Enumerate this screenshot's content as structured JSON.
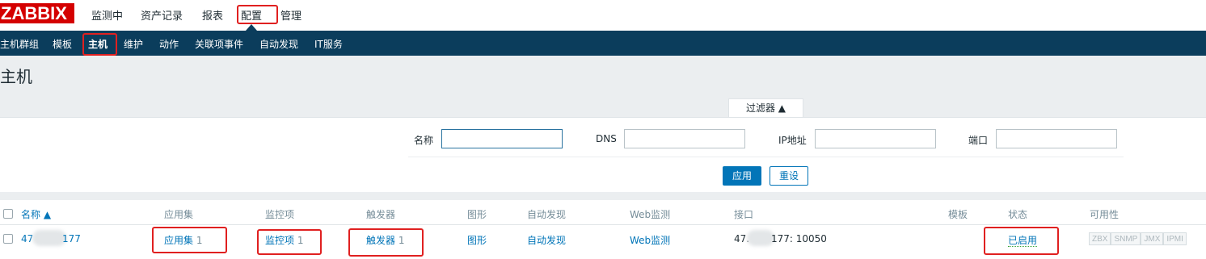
{
  "app": {
    "logo": "ZABBIX"
  },
  "top_menu": [
    {
      "label": "监测中"
    },
    {
      "label": "资产记录"
    },
    {
      "label": "报表"
    },
    {
      "label": "配置"
    },
    {
      "label": "管理"
    }
  ],
  "sub_menu": [
    {
      "label": "主机群组"
    },
    {
      "label": "模板"
    },
    {
      "label": "主机"
    },
    {
      "label": "维护"
    },
    {
      "label": "动作"
    },
    {
      "label": "关联项事件"
    },
    {
      "label": "自动发现"
    },
    {
      "label": "IT服务"
    }
  ],
  "page": {
    "title": "主机"
  },
  "filter": {
    "tab_label": "过滤器 ▲",
    "name_label": "名称",
    "name_value": "",
    "dns_label": "DNS",
    "dns_value": "",
    "ip_label": "IP地址",
    "ip_value": "",
    "port_label": "端口",
    "port_value": "",
    "apply_label": "应用",
    "reset_label": "重设"
  },
  "table": {
    "headers": {
      "name": "名称 ▲",
      "applications": "应用集",
      "items": "监控项",
      "triggers": "触发器",
      "graphs": "图形",
      "discovery": "自动发现",
      "web": "Web监测",
      "interface": "接口",
      "templates": "模板",
      "status": "状态",
      "availability": "可用性"
    },
    "rows": [
      {
        "name_prefix": "47",
        "name_suffix": "177",
        "applications": "应用集",
        "applications_count": "1",
        "items": "监控项",
        "items_count": "1",
        "triggers": "触发器",
        "triggers_count": "1",
        "graphs": "图形",
        "discovery": "自动发现",
        "web": "Web监测",
        "interface_prefix": "47.",
        "interface_suffix": "177: 10050",
        "templates": "",
        "status": "已启用",
        "availability": [
          "ZBX",
          "SNMP",
          "JMX",
          "IPMI"
        ]
      }
    ]
  },
  "colors": {
    "brand_red": "#d40000",
    "nav_dark": "#0b3d5c",
    "link_blue": "#0275b8",
    "enabled_green": "#3aa53a",
    "highlight_red": "#e02020"
  }
}
